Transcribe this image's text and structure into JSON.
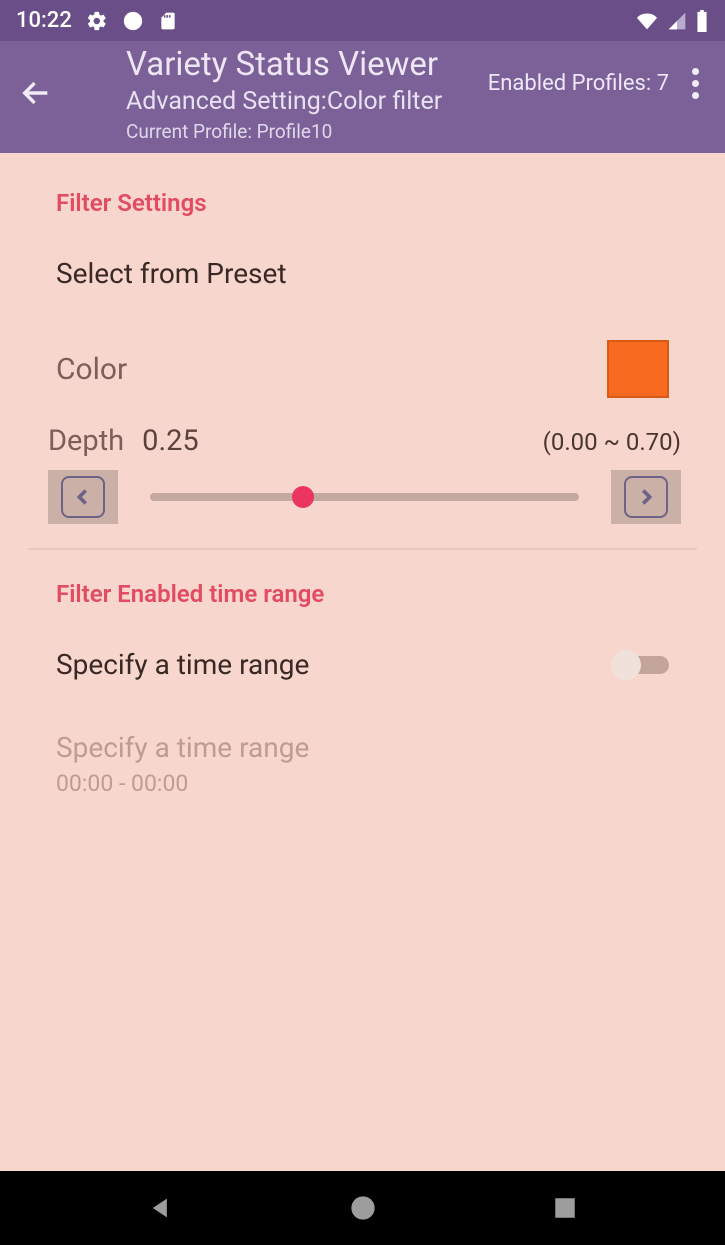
{
  "status": {
    "time": "10:22"
  },
  "header": {
    "title": "Variety Status Viewer",
    "subtitle": "Advanced Setting:Color filter",
    "profile_line": "Current Profile: Profile10",
    "enabled_profiles": "Enabled Profiles: 7"
  },
  "filter_settings": {
    "section_title": "Filter Settings",
    "preset_label": "Select from Preset",
    "color_label": "Color",
    "color_hex": "#f76a1f",
    "depth_label": "Depth",
    "depth_value": "0.25",
    "depth_range": "(0.00 ~ 0.70)",
    "slider_fraction": 0.357
  },
  "time_range": {
    "section_title": "Filter Enabled time range",
    "toggle_label": "Specify a time range",
    "toggle_on": false,
    "disabled_title": "Specify a time range",
    "disabled_value": "00:00 - 00:00"
  }
}
